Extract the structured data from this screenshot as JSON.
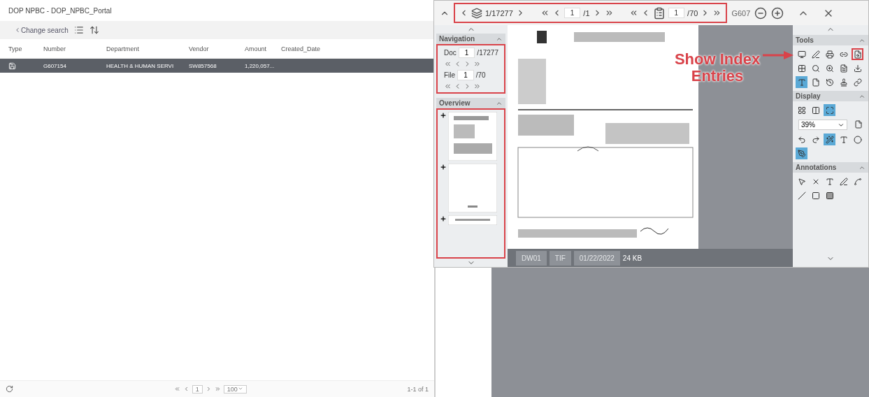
{
  "results": {
    "title": "DOP NPBC - DOP_NPBC_Portal",
    "change_search": "Change search",
    "columns": [
      "Type",
      "Number",
      "Department",
      "Vendor",
      "Amount",
      "Created_Date"
    ],
    "rows": [
      {
        "number": "G607154",
        "department": "HEALTH & HUMAN SERVI",
        "vendor": "SW857568",
        "amount": "1,220,057...",
        "created_date": "",
        "selected": true
      }
    ],
    "pager": {
      "page": "1",
      "page_size": "100",
      "summary": "1-1 of 1"
    }
  },
  "viewer": {
    "toolbar": {
      "doc_count": "1/17277",
      "page": "1",
      "page_total": "/1",
      "file": "1",
      "file_total": "/70",
      "doc_id": "G607"
    },
    "navigation": {
      "title": "Navigation",
      "doc_label": "Doc",
      "doc": "1",
      "doc_total": "/17277",
      "file_label": "File",
      "file": "1",
      "file_total": "/70"
    },
    "overview": {
      "title": "Overview",
      "thumbnails": [
        {
          "kind": "form"
        },
        {
          "kind": "blank"
        },
        {
          "kind": "strip"
        }
      ]
    },
    "info": [
      "DW01",
      "TIF",
      "01/22/2022"
    ],
    "size": "24 KB",
    "panels": [
      {
        "title": "Tools",
        "tools": [
          {
            "selected": false
          },
          {
            "selected": false
          },
          {
            "selected": false
          },
          {
            "selected": false
          },
          {
            "selected": false
          },
          {
            "selected": false
          },
          {
            "selected": false
          },
          {
            "selected": false
          },
          {
            "selected": false
          },
          {
            "selected": false
          },
          {
            "selected": true
          },
          {
            "selected": false
          },
          {
            "selected": false
          },
          {
            "selected": false
          },
          {
            "selected": false
          }
        ]
      },
      {
        "title": "Display",
        "zoom": "39%",
        "tools": [
          {
            "selected": false
          },
          {
            "selected": false
          },
          {
            "selected": true
          },
          {
            "selected": false
          },
          {
            "selected": false
          },
          {
            "selected": false
          },
          {
            "selected": true
          },
          {
            "selected": false
          },
          {
            "selected": false
          },
          {
            "selected": true
          }
        ]
      },
      {
        "title": "Annotations",
        "tools": [
          {
            "selected": false
          },
          {
            "selected": false
          },
          {
            "selected": false
          },
          {
            "selected": false
          },
          {
            "selected": false
          },
          {
            "selected": false
          },
          {
            "selected": false
          },
          {
            "selected": false
          }
        ]
      }
    ]
  },
  "callout": {
    "text": "Show Index Entries"
  }
}
